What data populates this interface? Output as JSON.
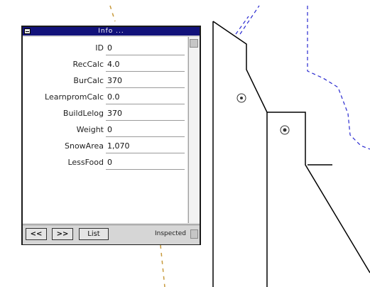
{
  "window": {
    "title": "Info ...",
    "fields": [
      {
        "label": "ID",
        "value": "0"
      },
      {
        "label": "RecCalc",
        "value": "4.0"
      },
      {
        "label": "BurCalc",
        "value": "370"
      },
      {
        "label": "LearnpromCalc",
        "value": "0.0"
      },
      {
        "label": "BuildLelog",
        "value": "370"
      },
      {
        "label": "Weight",
        "value": "0"
      },
      {
        "label": "SnowArea",
        "value": "1,070"
      },
      {
        "label": "LessFood",
        "value": "0"
      }
    ],
    "buttons": {
      "prev": "<<",
      "next": ">>",
      "list": "List"
    },
    "status": "Inspected"
  },
  "map": {
    "line_color": "#000000",
    "dashed_blue_color": "#2a2ad0",
    "dashed_yellow_color": "#c89a3c"
  }
}
